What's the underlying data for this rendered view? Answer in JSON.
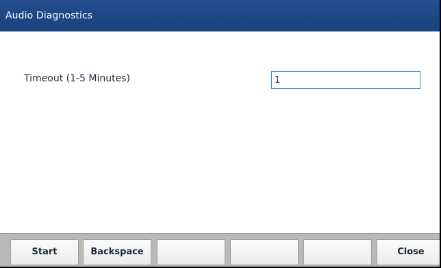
{
  "window": {
    "title": "Audio Diagnostics"
  },
  "form": {
    "timeout_label": "Timeout (1-5 Minutes)",
    "timeout_value": "1"
  },
  "softkeys": {
    "key1": "Start",
    "key2": "Backspace",
    "key3": "",
    "key4": "",
    "key5": "",
    "key6": "Close"
  },
  "colors": {
    "titlebar": "#1c4587",
    "softkey_bar": "#b9b9b9",
    "input_border": "#4a8ee0"
  }
}
